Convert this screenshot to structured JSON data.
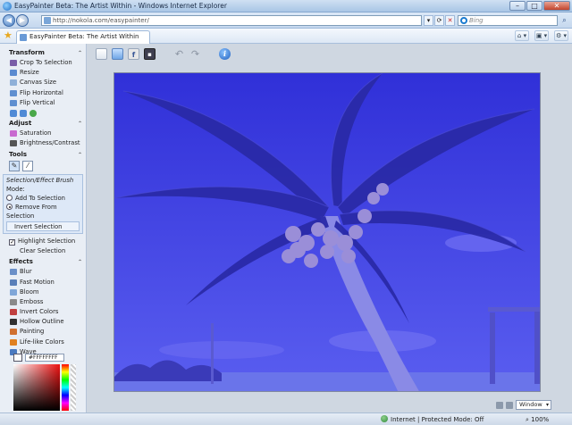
{
  "window": {
    "title": "EasyPainter Beta: The Artist Within - Windows Internet Explorer",
    "minimize": "–",
    "maximize": "□",
    "close": "✕"
  },
  "address_bar": {
    "url": "http://nokola.com/easypainter/",
    "search_placeholder": "Bing",
    "tools": [
      "▾",
      "⟳",
      "✕"
    ]
  },
  "tab": {
    "label": "EasyPainter Beta: The Artist Within"
  },
  "favorites_tools": [
    "⌂ ▾",
    "▣ ▾",
    "⚙ ▾"
  ],
  "panel": {
    "transform": {
      "title": "Transform",
      "items": [
        {
          "label": "Crop To Selection",
          "icon": "crop-icon",
          "color": "#7a5ea8"
        },
        {
          "label": "Resize",
          "icon": "resize-icon",
          "color": "#5a8ad0"
        },
        {
          "label": "Canvas Size",
          "icon": "canvas-size-icon",
          "color": "#8fb0d8"
        },
        {
          "label": "Flip Horizontal",
          "icon": "flip-horizontal-icon",
          "color": "#5f8fd0"
        },
        {
          "label": "Flip Vertical",
          "icon": "flip-vertical-icon",
          "color": "#5f8fd0"
        }
      ]
    },
    "adjust": {
      "title": "Adjust",
      "items": [
        {
          "label": "Saturation",
          "icon": "saturation-icon",
          "color": "#c86ad0"
        },
        {
          "label": "Brightness/Contrast",
          "icon": "brightness-icon",
          "color": "#555555"
        }
      ]
    },
    "tools": {
      "title": "Tools",
      "brush_title": "Selection/Effect Brush",
      "mode_label": "Mode:",
      "add_label": "Add To Selection",
      "remove_label": "Remove From Selection",
      "invert_label": "Invert Selection",
      "highlight_label": "Highlight Selection",
      "clear_label": "Clear Selection"
    },
    "effects": {
      "title": "Effects",
      "items": [
        {
          "label": "Blur",
          "icon": "blur-icon",
          "color": "#6a8fc8"
        },
        {
          "label": "Fast Motion",
          "icon": "fast-motion-icon",
          "color": "#5a7fb8"
        },
        {
          "label": "Bloom",
          "icon": "bloom-icon",
          "color": "#7fa6d8"
        },
        {
          "label": "Emboss",
          "icon": "emboss-icon",
          "color": "#8a8a8a"
        },
        {
          "label": "Invert Colors",
          "icon": "invert-colors-icon",
          "color": "#c04040"
        },
        {
          "label": "Hollow Outline",
          "icon": "hollow-outline-icon",
          "color": "#303030"
        },
        {
          "label": "Painting",
          "icon": "painting-icon",
          "color": "#d07030"
        },
        {
          "label": "Life-like Colors",
          "icon": "life-like-colors-icon",
          "color": "#e08020"
        },
        {
          "label": "Wave",
          "icon": "wave-icon",
          "color": "#4a7ac0"
        }
      ]
    },
    "color": {
      "hex": "#FFFFFFFF"
    }
  },
  "toolbar": {
    "fb_label": "f",
    "save_label": "▪",
    "undo_label": "↶",
    "redo_label": "↷",
    "info_label": "i"
  },
  "view": {
    "zoom_mode": "Window"
  },
  "status": {
    "zone": "Internet | Protected Mode: Off",
    "zoom": "100%"
  }
}
